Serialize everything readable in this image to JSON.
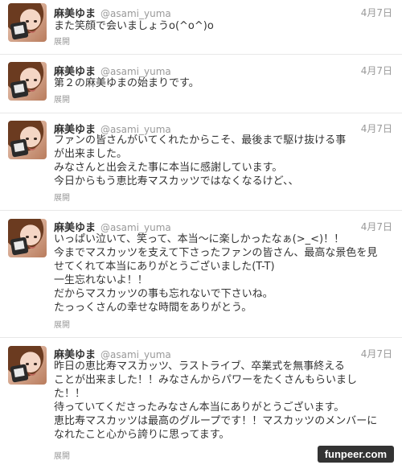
{
  "user": {
    "name": "麻美ゆま",
    "handle": "@asami_yuma"
  },
  "expand_label": "展開",
  "tweets": [
    {
      "date": "4月7日",
      "text": "また笑顔で会いましょうo(^o^)o"
    },
    {
      "date": "4月7日",
      "text": "第２の麻美ゆまの始まりです。"
    },
    {
      "date": "4月7日",
      "text": "ファンの皆さんがいてくれたからこそ、最後まで駆け抜ける事\nが出来ました。\nみなさんと出会えた事に本当に感謝しています。\n今日からもう恵比寿マスカッツではなくなるけど、、"
    },
    {
      "date": "4月7日",
      "text": "いっぱい泣いて、笑って、本当～に楽しかったなぁ(>_<)！！\n今までマスカッツを支えて下さったファンの皆さん、最高な景色を見\nせてくれて本当にありがとうございました(T-T)\n一生忘れないよ！！\nだからマスカッツの事も忘れないで下さいね。\nたっっくさんの幸せな時間をありがとう。"
    },
    {
      "date": "4月7日",
      "text": "昨日の恵比寿マスカッツ、ラストライブ、卒業式を無事終える\nことが出来ました！！みなさんからパワーをたくさんもらいまし\nた！！\n待っていてくださったみなさん本当にありがとうございます。\n恵比寿マスカッツは最高のグループです！！マスカッツのメンバーに\nなれたこと心から誇りに思ってます。"
    }
  ],
  "watermark": "funpeer.com"
}
